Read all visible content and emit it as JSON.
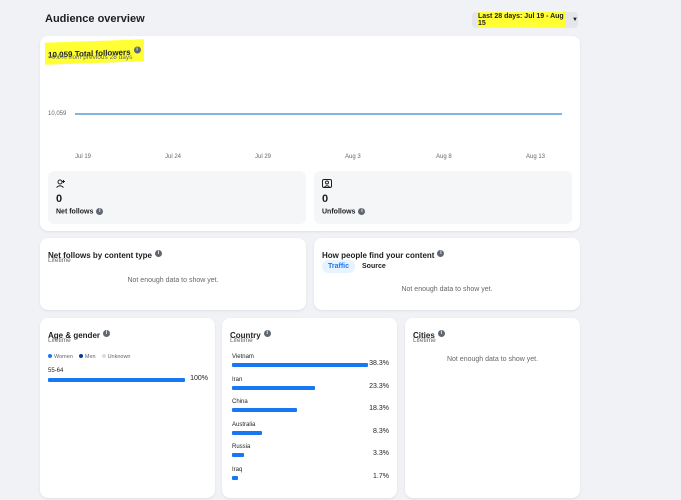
{
  "header": {
    "title": "Audience overview",
    "date_range": "Last 28 days: Jul 19 - Aug 15"
  },
  "followers": {
    "total": "10,059 Total followers",
    "change": "+0.0% from previous 28 days",
    "y_label": "10,059",
    "x_ticks": [
      "Jul 19",
      "Jul 24",
      "Jul 29",
      "Aug 3",
      "Aug 8",
      "Aug 13"
    ],
    "net_follows": {
      "value": "0",
      "label": "Net follows",
      "icon": "user-add-icon"
    },
    "unfollows": {
      "value": "0",
      "label": "Unfollows",
      "icon": "user-remove-icon"
    }
  },
  "chart_data": {
    "type": "line",
    "x": [
      "Jul 19",
      "Jul 24",
      "Jul 29",
      "Aug 3",
      "Aug 8",
      "Aug 13"
    ],
    "series": [
      {
        "values": [
          10059,
          10059,
          10059,
          10059,
          10059,
          10059
        ]
      }
    ],
    "color": "#5b9bd5"
  },
  "net_follows_by_content": {
    "title": "Net follows by content type",
    "period": "Lifetime",
    "empty": "Not enough data to show yet."
  },
  "how_people_find": {
    "title": "How people find your content",
    "tabs": [
      "Traffic",
      "Source"
    ],
    "empty": "Not enough data to show yet."
  },
  "age_gender": {
    "title": "Age & gender",
    "period": "Lifetime",
    "legend": [
      "Women",
      "Men",
      "Unknown"
    ],
    "legend_colors": [
      "#1877f2",
      "#0a3d91",
      "#dadde1"
    ],
    "rows": [
      {
        "label": "55-64",
        "pct": "100%",
        "fraction": 1.0
      }
    ]
  },
  "country": {
    "title": "Country",
    "period": "Lifetime",
    "rows": [
      {
        "name": "Vietnam",
        "pct": "38.3%",
        "fraction": 1.0
      },
      {
        "name": "Iran",
        "pct": "23.3%",
        "fraction": 0.608
      },
      {
        "name": "China",
        "pct": "18.3%",
        "fraction": 0.478
      },
      {
        "name": "Australia",
        "pct": "8.3%",
        "fraction": 0.217
      },
      {
        "name": "Russia",
        "pct": "3.3%",
        "fraction": 0.086
      },
      {
        "name": "Iraq",
        "pct": "1.7%",
        "fraction": 0.044
      }
    ]
  },
  "cities": {
    "title": "Cities",
    "period": "Lifetime",
    "empty": "Not enough data to show yet."
  }
}
